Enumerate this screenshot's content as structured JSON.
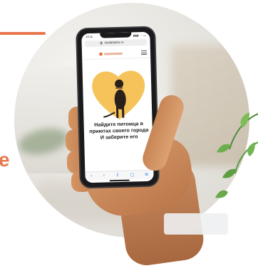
{
  "page": {
    "edge_text": "e",
    "accent_color": "#e9774d"
  },
  "phone": {
    "status": {
      "time": "10:11",
      "icons": "▮▮▮ ◔ ▭"
    },
    "browser": {
      "url": "irisdatasbo.ru"
    },
    "site": {
      "logo_label": "",
      "hero": {
        "heart_color": "#f5c35a",
        "dog_color": "#2b1f1b"
      },
      "headline_lines": [
        "Найдите питомца в",
        "приютах своего города",
        "И заберите его"
      ]
    },
    "toolbar": {
      "icons": [
        "back-icon",
        "forward-icon",
        "share-icon",
        "bookmarks-icon",
        "tabs-icon"
      ],
      "glyphs": [
        "‹",
        "›",
        "⇪",
        "▢",
        "⧉"
      ]
    }
  }
}
